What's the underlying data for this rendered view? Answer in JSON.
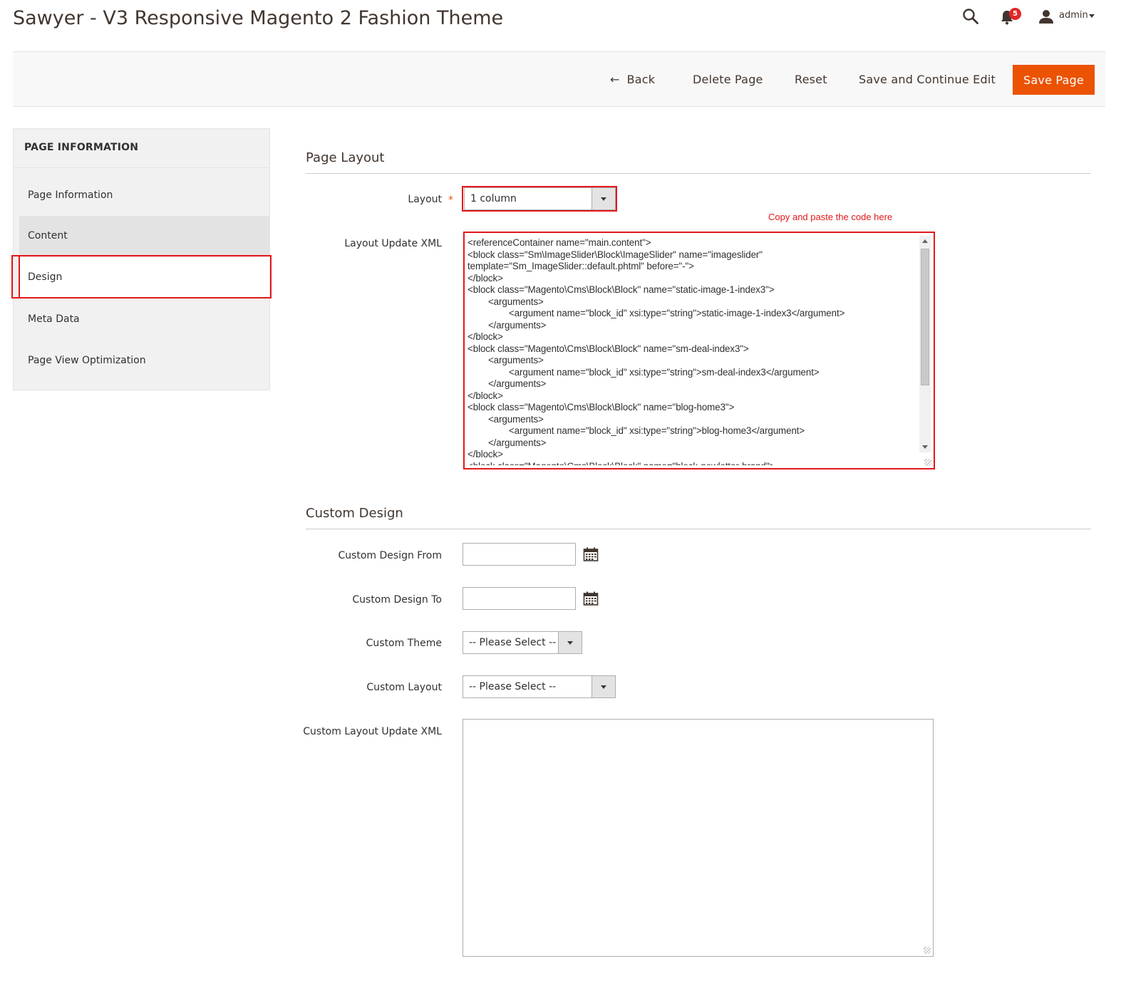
{
  "header": {
    "title": "Sawyer - V3 Responsive Magento 2 Fashion Theme",
    "notifications_count": "5",
    "user_name": "admin",
    "icons": [
      "search-icon",
      "bell-icon",
      "user-icon",
      "chevron-down-icon"
    ]
  },
  "actions": {
    "back": "Back",
    "delete": "Delete Page",
    "reset": "Reset",
    "save_continue": "Save and Continue Edit",
    "save": "Save Page"
  },
  "sidebar": {
    "title": "PAGE INFORMATION",
    "items": [
      {
        "label": "Page Information"
      },
      {
        "label": "Content"
      },
      {
        "label": "Design"
      },
      {
        "label": "Meta Data"
      },
      {
        "label": "Page View Optimization"
      }
    ]
  },
  "page_layout": {
    "title": "Page Layout",
    "layout_label": "Layout",
    "required_mark": "*",
    "layout_value": "1 column",
    "hint": "Copy and paste the code here",
    "xml_label": "Layout Update XML",
    "xml_value": "<referenceContainer name=\"main.content\">\n<block class=\"Sm\\ImageSlider\\Block\\ImageSlider\" name=\"imageslider\"\ntemplate=\"Sm_ImageSlider::default.phtml\" before=\"-\">\n</block>\n<block class=\"Magento\\Cms\\Block\\Block\" name=\"static-image-1-index3\">\n        <arguments>\n                <argument name=\"block_id\" xsi:type=\"string\">static-image-1-index3</argument>\n        </arguments>\n</block>\n<block class=\"Magento\\Cms\\Block\\Block\" name=\"sm-deal-index3\">\n        <arguments>\n                <argument name=\"block_id\" xsi:type=\"string\">sm-deal-index3</argument>\n        </arguments>\n</block>\n<block class=\"Magento\\Cms\\Block\\Block\" name=\"blog-home3\">\n        <arguments>\n                <argument name=\"block_id\" xsi:type=\"string\">blog-home3</argument>\n        </arguments>\n</block>\n<block class=\"Magento\\Cms\\Block\\Block\" name=\"block-newletter-brand\">"
  },
  "custom_design": {
    "title": "Custom Design",
    "from_label": "Custom Design From",
    "from_value": "",
    "to_label": "Custom Design To",
    "to_value": "",
    "theme_label": "Custom Theme",
    "theme_value": "-- Please Select --",
    "layout_label": "Custom Layout",
    "layout_value": "-- Please Select --",
    "xml_label": "Custom Layout Update XML",
    "xml_value": ""
  },
  "colors": {
    "accent": "#eb5202",
    "highlight": "#e3171a",
    "badge": "#e22626"
  }
}
